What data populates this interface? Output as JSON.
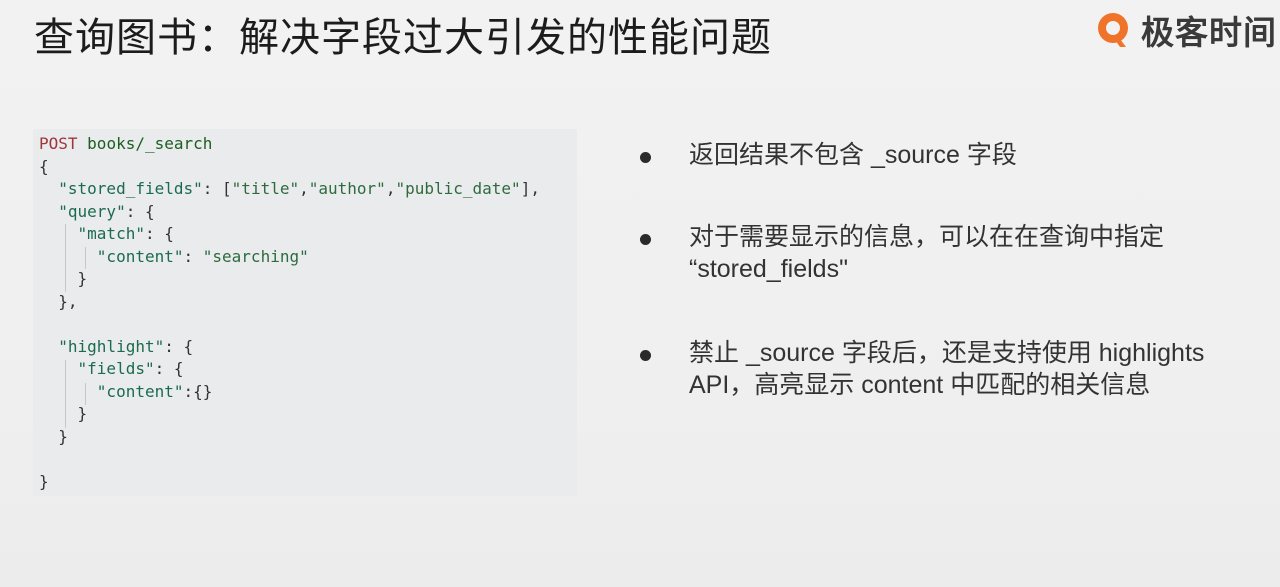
{
  "title": "查询图书：解决字段过大引发的性能问题",
  "logo": {
    "text": "极客时间",
    "accent": "#f0732a"
  },
  "code": {
    "method": "POST",
    "path": "books/_search",
    "lines": [
      "{",
      "  \"stored_fields\": [\"title\",\"author\",\"public_date\"],",
      "  \"query\": {",
      "    \"match\": {",
      "      \"content\": \"searching\"",
      "    }",
      "  },",
      "",
      "  \"highlight\": {",
      "    \"fields\": {",
      "      \"content\":{}",
      "    }",
      "  }",
      "",
      "}"
    ]
  },
  "bullets": [
    {
      "lines": [
        "返回结果不包含 _source 字段"
      ]
    },
    {
      "lines": [
        "对于需要显示的信息，可以在在查询中指定",
        "“stored_fields\""
      ]
    },
    {
      "lines": [
        "禁止 _source 字段后，还是支持使用 highlights",
        "API，高亮显示 content 中匹配的相关信息"
      ]
    }
  ]
}
